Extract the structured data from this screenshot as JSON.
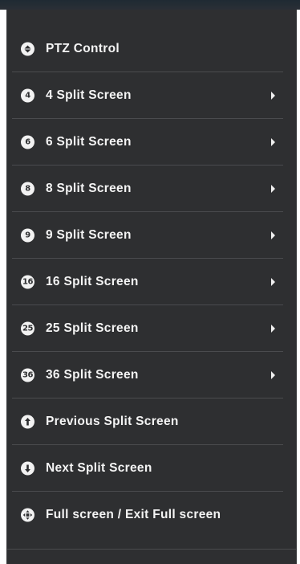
{
  "menu": {
    "items": [
      {
        "label": "PTZ Control",
        "icon": "ptz-icon",
        "badge": "",
        "submenu": false
      },
      {
        "label": "4 Split Screen",
        "icon": "split-4-icon",
        "badge": "4",
        "submenu": true
      },
      {
        "label": "6 Split Screen",
        "icon": "split-6-icon",
        "badge": "6",
        "submenu": true
      },
      {
        "label": "8 Split Screen",
        "icon": "split-8-icon",
        "badge": "8",
        "submenu": true
      },
      {
        "label": "9 Split Screen",
        "icon": "split-9-icon",
        "badge": "9",
        "submenu": true
      },
      {
        "label": "16 Split Screen",
        "icon": "split-16-icon",
        "badge": "16",
        "submenu": true
      },
      {
        "label": "25 Split Screen",
        "icon": "split-25-icon",
        "badge": "25",
        "submenu": true
      },
      {
        "label": "36 Split Screen",
        "icon": "split-36-icon",
        "badge": "36",
        "submenu": true
      },
      {
        "label": "Previous Split Screen",
        "icon": "previous-arrow-icon",
        "badge": "",
        "submenu": false
      },
      {
        "label": "Next Split Screen",
        "icon": "next-arrow-icon",
        "badge": "",
        "submenu": false
      },
      {
        "label": "Full screen / Exit Full screen",
        "icon": "fullscreen-icon",
        "badge": "",
        "submenu": false
      }
    ]
  },
  "colors": {
    "menu_background": "#2e2f31",
    "text": "#f4f4f4",
    "divider": "#4a4b4e",
    "icon_fill": "#f2f2f2"
  }
}
